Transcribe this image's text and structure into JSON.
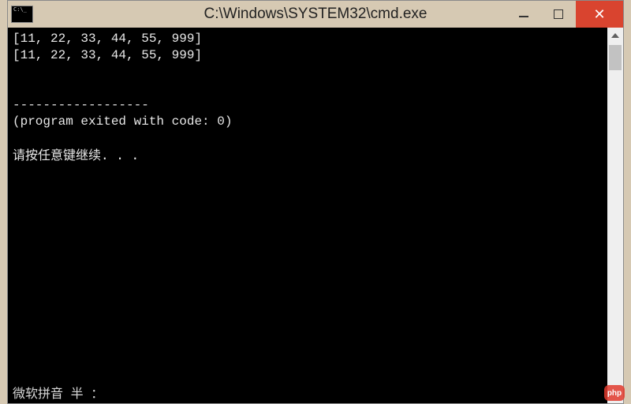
{
  "window": {
    "title": "C:\\Windows\\SYSTEM32\\cmd.exe",
    "app_icon_text": "C:\\_"
  },
  "terminal": {
    "lines": {
      "l1": "[11, 22, 33, 44, 55, 999]",
      "l2": "[11, 22, 33, 44, 55, 999]",
      "blank1": "",
      "blank2": "",
      "sep": "------------------",
      "exit": "(program exited with code: 0)",
      "blank3": "",
      "press": "请按任意键继续. . ."
    },
    "bottom": "微软拼音 半 ："
  },
  "watermark": {
    "text": "php"
  }
}
